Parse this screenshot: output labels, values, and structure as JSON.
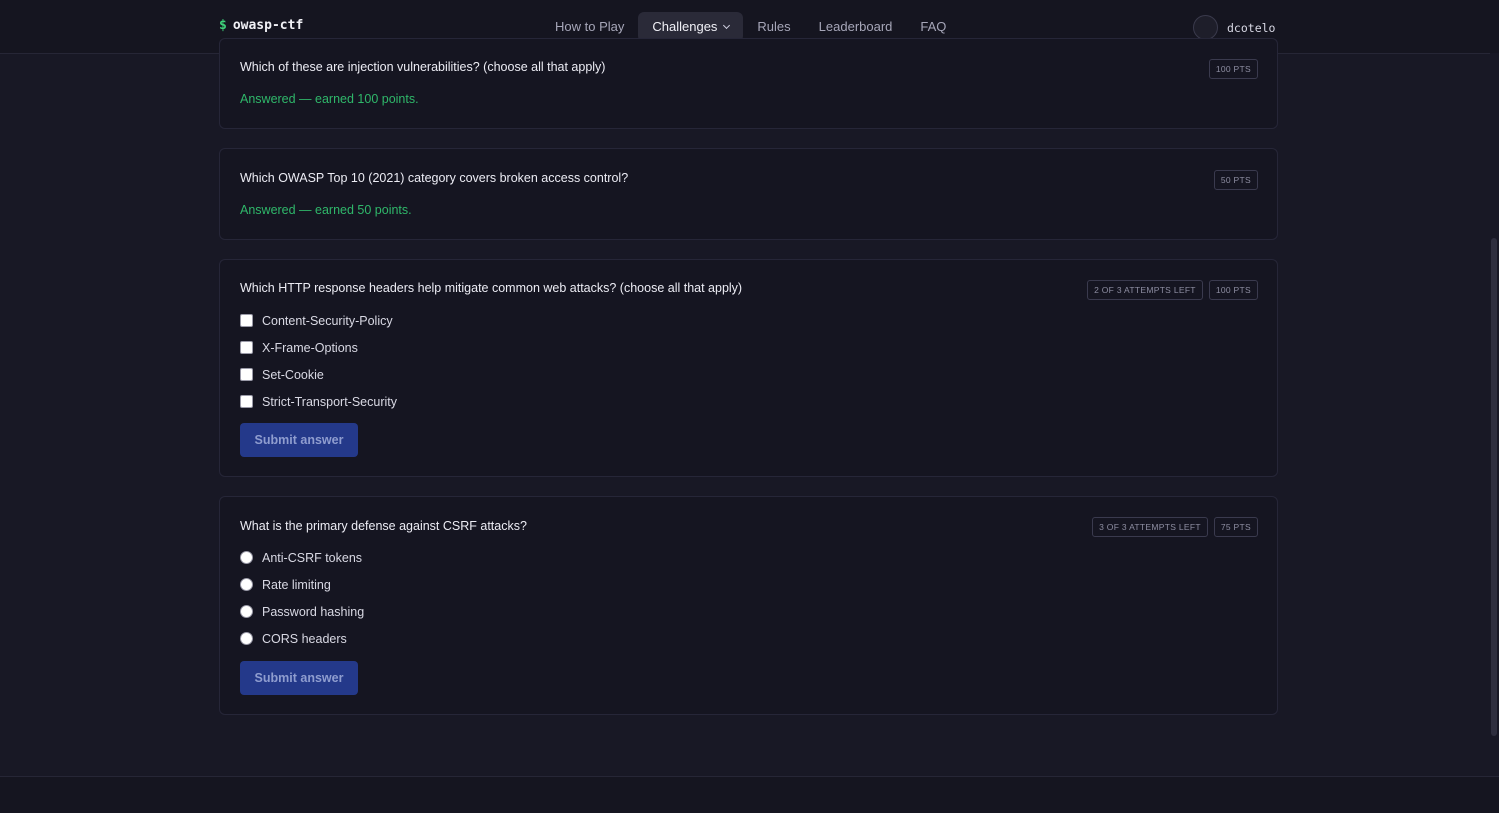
{
  "brand": {
    "symbol": "$",
    "name": "owasp-ctf"
  },
  "nav": {
    "items": [
      {
        "label": "How to Play",
        "active": false
      },
      {
        "label": "Challenges",
        "active": true
      },
      {
        "label": "Rules",
        "active": false
      },
      {
        "label": "Leaderboard",
        "active": false
      },
      {
        "label": "FAQ",
        "active": false
      }
    ]
  },
  "user": {
    "username": "dcotelo"
  },
  "questions": [
    {
      "text": "Which of these are injection vulnerabilities? (choose all that apply)",
      "points": "100 PTS",
      "status": "Answered — earned 100 points."
    },
    {
      "text": "Which OWASP Top 10 (2021) category covers broken access control?",
      "points": "50 PTS",
      "status": "Answered — earned 50 points."
    },
    {
      "text": "Which HTTP response headers help mitigate common web attacks? (choose all that apply)",
      "attempts": "2 OF 3 ATTEMPTS LEFT",
      "points": "100 PTS",
      "options": [
        "Content-Security-Policy",
        "X-Frame-Options",
        "Set-Cookie",
        "Strict-Transport-Security"
      ],
      "submit_label": "Submit answer"
    },
    {
      "text": "What is the primary defense against CSRF attacks?",
      "attempts": "3 OF 3 ATTEMPTS LEFT",
      "points": "75 PTS",
      "options": [
        "Anti-CSRF tokens",
        "Rate limiting",
        "Password hashing",
        "CORS headers"
      ],
      "submit_label": "Submit answer"
    }
  ],
  "colors": {
    "accent": "#3ed07a",
    "answered": "#2fb76a",
    "button": "#24398a",
    "background": "#181825"
  }
}
